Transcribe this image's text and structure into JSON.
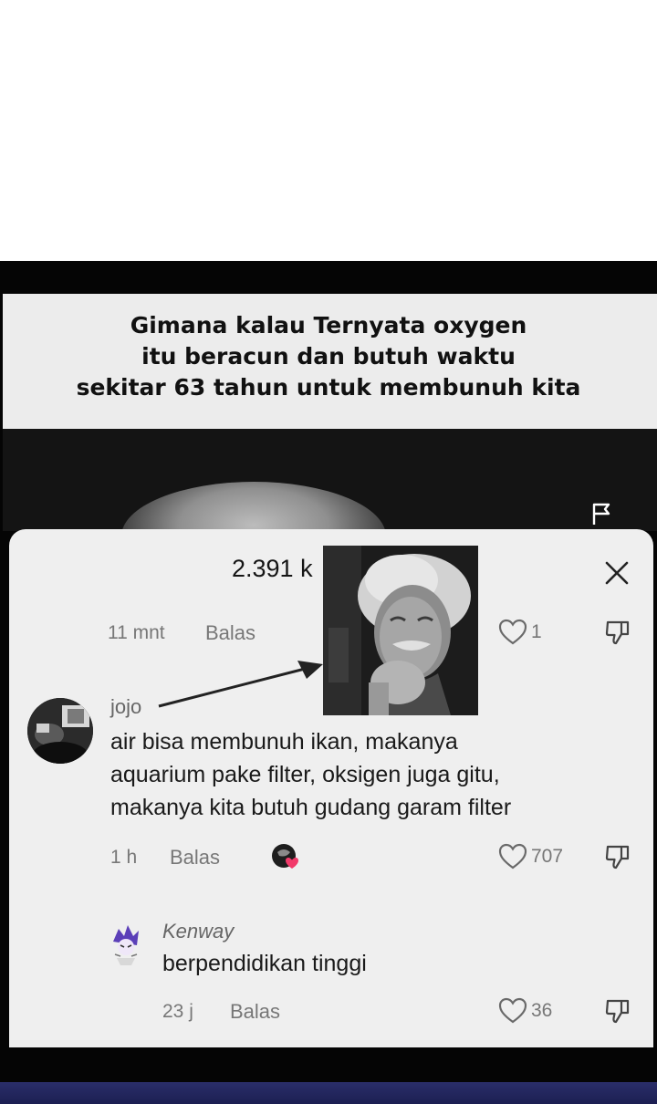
{
  "caption": {
    "lines": [
      "Gimana kalau Ternyata oxygen",
      "itu beracun dan butuh waktu",
      "sekitar 63 tahun untuk membunuh kita"
    ]
  },
  "comments_header": {
    "count": "2.391 k"
  },
  "top_comment": {
    "time": "11 mnt",
    "reply_label": "Balas",
    "likes": "1"
  },
  "comment_jojo": {
    "username": "jojo",
    "lines": [
      "air bisa membunuh ikan, makanya",
      "aquarium pake filter, oksigen juga gitu,",
      "makanya kita butuh gudang garam filter"
    ],
    "time": "1 h",
    "reply_label": "Balas",
    "likes": "707"
  },
  "comment_kenway": {
    "username": "Kenway",
    "text": "berpendidikan tinggi",
    "time": "23 j",
    "reply_label": "Balas",
    "likes": "36"
  },
  "icons": [
    "flag-icon",
    "close-icon",
    "heart-icon",
    "dislike-icon",
    "arrow-icon"
  ],
  "colors": {
    "sheet_bg": "#efefef",
    "frame_bg": "#050505",
    "bottom_bar": "#2a2e6a"
  }
}
